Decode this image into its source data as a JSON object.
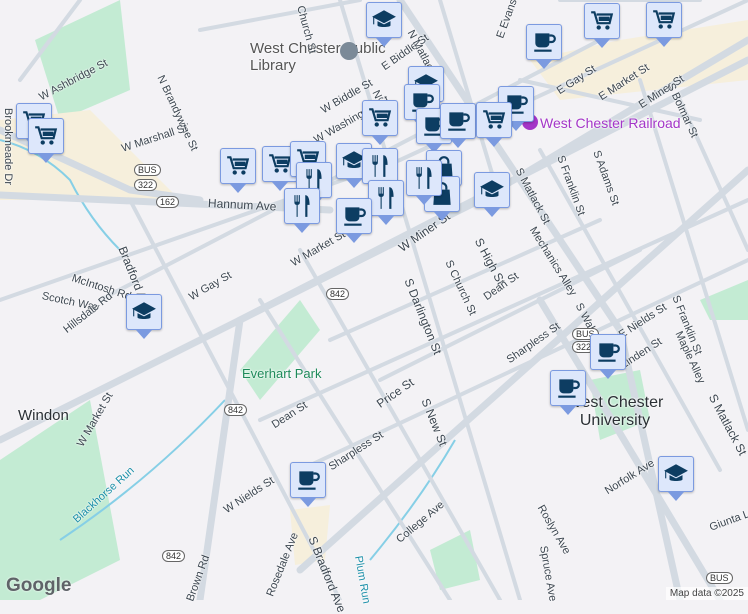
{
  "map": {
    "colors": {
      "background": "#f3f2f5",
      "road": "#d3dae2",
      "park": "#c3ebd3",
      "marker_fill": "#dde7fb",
      "marker_icon": "#0d3d62",
      "poi": "#a436c8"
    },
    "places": {
      "library": "West Chester Public Library",
      "railroad": "West Chester Railroad",
      "park": "Everhart Park",
      "windon": "Windon",
      "university": "West Chester University",
      "blackhorse": "Blackhorse Run",
      "plum": "Plum Run"
    },
    "streets": [
      "W Ashbridge St",
      "N Brandywine St",
      "W Marshall St",
      "W Biddle St",
      "E Biddle St",
      "N Matlack St",
      "E Evans St",
      "E Gay St",
      "E Market St",
      "E Miner St",
      "S Bolmar St",
      "W Washington St",
      "N High St",
      "Hannum Ave",
      "Bradford Ave",
      "McIntosh Rd",
      "Scotch Way",
      "Hillsdale Rd",
      "W Gay St",
      "W Market St",
      "W Miner St",
      "S Darlington St",
      "S Church St",
      "S High St",
      "S Matlack St",
      "S Franklin St",
      "S Adams St",
      "Mechanics Alley",
      "Dean St",
      "S Walnut St",
      "E Nields St",
      "S Franklin St",
      "Maple Alley",
      "Sharpless St",
      "Linden St",
      "Price St",
      "S New St",
      "W Market St",
      "Dean St",
      "Sharpless St",
      "W Nields St",
      "S Bradford Ave",
      "College Ave",
      "Rosedale Ave",
      "Roslyn Ave",
      "Spruce Ave",
      "Norfolk Ave",
      "S Matlack St",
      "Giunta Ln",
      "Brookmeade Dr",
      "Church St",
      "Brown Rd"
    ],
    "shields": [
      "BUS",
      "322",
      "162",
      "842",
      "842",
      "842",
      "BUS",
      "322",
      "BUS"
    ],
    "markers": [
      "school",
      "cart",
      "cart",
      "coffee",
      "cart",
      "school",
      "coffee",
      "cart",
      "cart",
      "coffee",
      "coffee",
      "coffee",
      "cart",
      "cart",
      "cart",
      "cart",
      "food",
      "food",
      "school",
      "food",
      "food",
      "bag",
      "bag",
      "food",
      "school",
      "coffee",
      "school",
      "coffee",
      "coffee",
      "coffee",
      "school"
    ],
    "attribution": "Map data ©2025",
    "logo": "Google"
  }
}
